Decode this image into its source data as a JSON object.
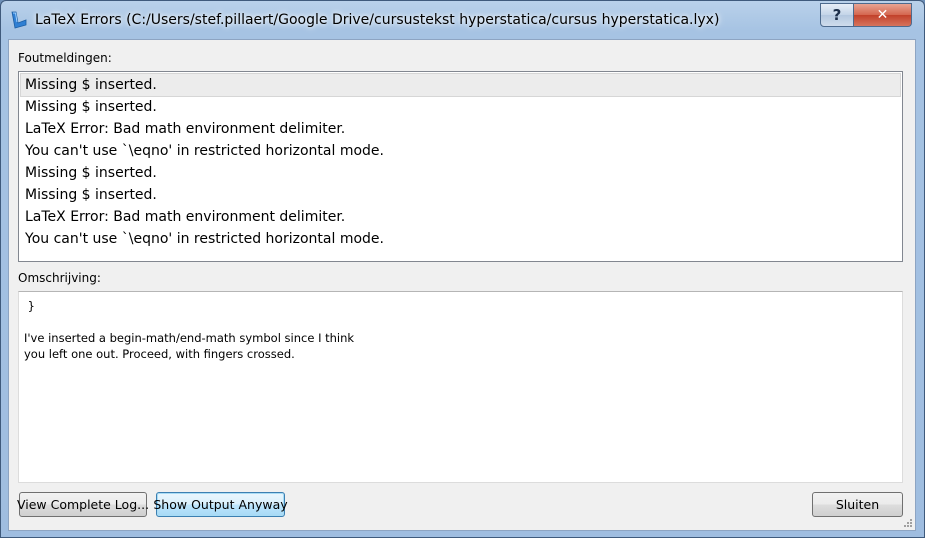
{
  "window": {
    "title": "LaTeX Errors (C:/Users/stef.pillaert/Google Drive/cursustekst hyperstatica/cursus hyperstatica.lyx)",
    "help_glyph": "?",
    "close_glyph": "✕"
  },
  "errors": {
    "label": "Foutmeldingen:",
    "items": [
      "Missing $ inserted.",
      "Missing $ inserted.",
      "LaTeX Error: Bad math environment delimiter.",
      "You can't use `\\eqno' in restricted horizontal mode.",
      "Missing $ inserted.",
      "Missing $ inserted.",
      "LaTeX Error: Bad math environment delimiter.",
      "You can't use `\\eqno' in restricted horizontal mode."
    ],
    "selected_index": 0
  },
  "description": {
    "label": "Omschrijving:",
    "lines": [
      " }",
      "",
      "I've inserted a begin-math/end-math symbol since I think",
      "you left one out. Proceed, with fingers crossed."
    ]
  },
  "buttons": {
    "view_log": "View Complete Log...",
    "show_output": "Show Output Anyway",
    "close": "Sluiten"
  },
  "colors": {
    "accent": "#3c7fb1",
    "close_button": "#c2412a"
  }
}
